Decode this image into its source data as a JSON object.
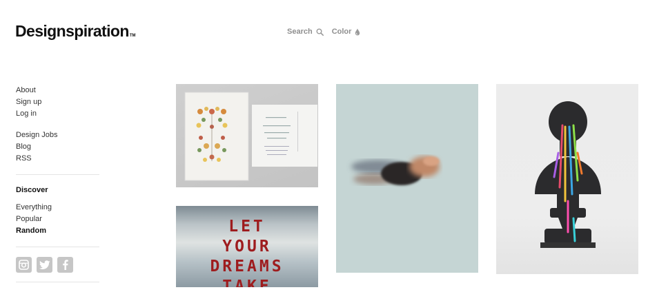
{
  "header": {
    "logo": "Designspiration",
    "tm": "TM",
    "nav": [
      {
        "label": "Search",
        "icon": "search-icon"
      },
      {
        "label": "Color",
        "icon": "droplet-icon"
      }
    ]
  },
  "sidebar": {
    "account": [
      "About",
      "Sign up",
      "Log in"
    ],
    "links": [
      "Design Jobs",
      "Blog",
      "RSS"
    ],
    "discover_heading": "Discover",
    "discover": [
      "Everything",
      "Popular",
      "Random"
    ],
    "social_icons": [
      "instagram-icon",
      "twitter-icon",
      "facebook-icon"
    ]
  },
  "tiles": {
    "poster_lines": [
      "LET",
      "YOUR",
      "DREAMS",
      "TAKE"
    ]
  },
  "colors": {
    "text": "#333333",
    "nav_gray": "#8f8f8f",
    "social_gray": "#c6c6c6",
    "poster_red": "#9e1c1e"
  }
}
